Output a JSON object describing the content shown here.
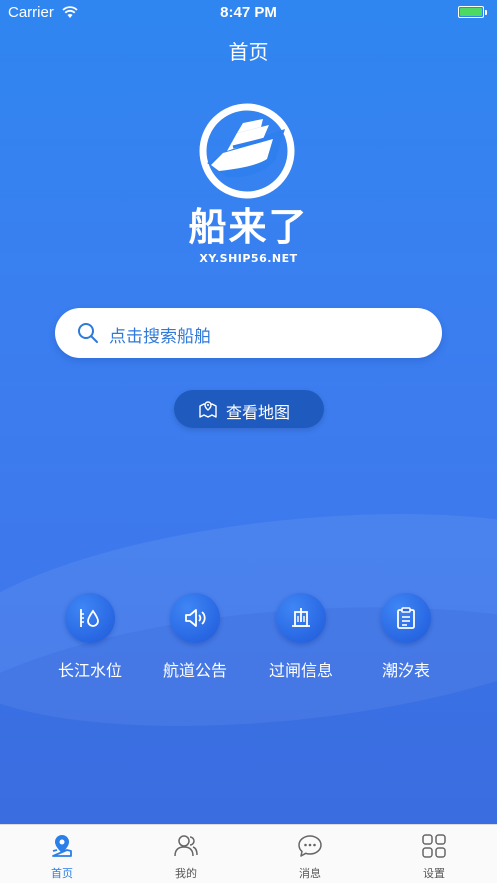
{
  "status_bar": {
    "carrier": "Carrier",
    "time": "8:47 PM"
  },
  "nav": {
    "title": "首页"
  },
  "brand": {
    "name": "船来了",
    "url": "XY.SHIP56.NET"
  },
  "search": {
    "placeholder": "点击搜索船舶",
    "icon": "search-icon"
  },
  "map_button": {
    "label": "查看地图",
    "icon": "map-icon"
  },
  "features": [
    {
      "label": "长江水位",
      "icon": "water-level-icon"
    },
    {
      "label": "航道公告",
      "icon": "speaker-icon"
    },
    {
      "label": "过闸信息",
      "icon": "lock-gate-icon"
    },
    {
      "label": "潮汐表",
      "icon": "clipboard-icon"
    }
  ],
  "tabs": [
    {
      "label": "首页",
      "icon": "location-pin-icon",
      "active": true
    },
    {
      "label": "我的",
      "icon": "users-icon",
      "active": false
    },
    {
      "label": "消息",
      "icon": "chat-bubble-icon",
      "active": false
    },
    {
      "label": "设置",
      "icon": "grid-icon",
      "active": false
    }
  ],
  "colors": {
    "primary": "#2f86f0",
    "tab_active": "#2b7fe8",
    "map_button": "#1f5bbf",
    "battery": "#4cd964"
  }
}
